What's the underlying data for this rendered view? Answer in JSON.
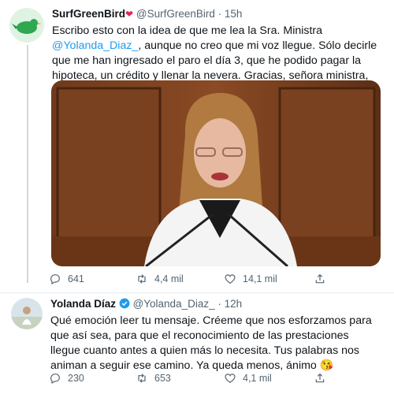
{
  "tweets": [
    {
      "display_name": "SurfGreenBird",
      "name_emoji": "❤",
      "handle": "@SurfGreenBird",
      "separator": "·",
      "time": "15h",
      "text_before": "Escribo esto con la idea de que me lea la Sra. Ministra ",
      "mention": "@Yolanda_Diaz_",
      "text_after": ", aunque no creo que mi voz llegue. Sólo decirle que me han ingresado el paro el día 3, que he podido pagar la hipoteca, un crédito y llenar la nevera. Gracias, señora ministra, de corazón.",
      "reply_count": "641",
      "retweet_count": "4,4 mil",
      "like_count": "14,1 mil"
    },
    {
      "display_name": "Yolanda Díaz",
      "handle": "@Yolanda_Diaz_",
      "separator": "·",
      "time": "12h",
      "text": "Qué emoción leer tu mensaje. Créeme que nos esforzamos para que así sea, para que el reconocimiento de las prestaciones llegue cuanto antes a quien más lo necesita. Tus palabras nos animan a seguir ese camino. Ya queda menos, ánimo 😘",
      "reply_count": "230",
      "retweet_count": "653",
      "like_count": "4,1 mil"
    }
  ],
  "colors": {
    "accent": "#1d9bf0",
    "verified": "#1d9bf0",
    "muted": "#536471",
    "heart": "#e0245e"
  },
  "icons": [
    "reply-icon",
    "retweet-icon",
    "like-icon",
    "share-icon",
    "verified-badge-icon"
  ]
}
